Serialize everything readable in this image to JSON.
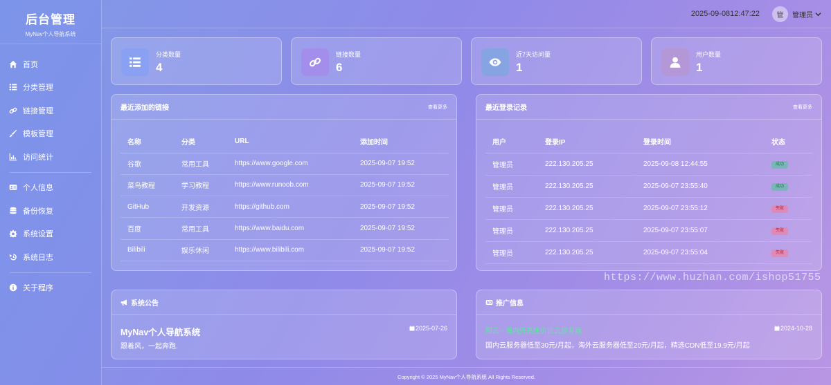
{
  "brand": {
    "title": "后台管理",
    "subtitle": "MyNav个人导航系统"
  },
  "nav": [
    {
      "label": "首页",
      "icon": "home-icon"
    },
    {
      "label": "分类管理",
      "icon": "list-icon"
    },
    {
      "label": "链接管理",
      "icon": "link-icon"
    },
    {
      "label": "模板管理",
      "icon": "brush-icon"
    },
    {
      "label": "访问统计",
      "icon": "chart-icon"
    },
    {
      "label": "个人信息",
      "icon": "id-card-icon"
    },
    {
      "label": "备份恢复",
      "icon": "database-icon"
    },
    {
      "label": "系统设置",
      "icon": "gear-icon"
    },
    {
      "label": "系统日志",
      "icon": "history-icon"
    },
    {
      "label": "关于程序",
      "icon": "info-icon"
    }
  ],
  "header": {
    "datetime": "2025-09-0812:47:22",
    "avatar_text": "管",
    "user_label": "管理员"
  },
  "stats": [
    {
      "label": "分类数量",
      "value": "4",
      "icon": "list-icon",
      "color": "#8aa0f2"
    },
    {
      "label": "链接数量",
      "value": "6",
      "icon": "link-icon",
      "color": "#a48eec"
    },
    {
      "label": "近7天访问量",
      "value": "1",
      "icon": "eye-icon",
      "color": "#86a4e2"
    },
    {
      "label": "用户数量",
      "value": "1",
      "icon": "user-icon",
      "color": "#b497d6"
    }
  ],
  "recent_links": {
    "title": "最近添加的链接",
    "more": "查看更多",
    "headers": [
      "名称",
      "分类",
      "URL",
      "添加时间"
    ],
    "rows": [
      [
        "谷歌",
        "常用工具",
        "https://www.google.com",
        "2025-09-07 19:52"
      ],
      [
        "菜鸟教程",
        "学习教程",
        "https://www.runoob.com",
        "2025-09-07 19:52"
      ],
      [
        "GitHub",
        "开发资源",
        "https://github.com",
        "2025-09-07 19:52"
      ],
      [
        "百度",
        "常用工具",
        "https://www.baidu.com",
        "2025-09-07 19:52"
      ],
      [
        "Bilibili",
        "娱乐休闲",
        "https://www.bilibili.com",
        "2025-09-07 19:52"
      ]
    ]
  },
  "recent_logins": {
    "title": "最近登录记录",
    "more": "查看更多",
    "headers": [
      "用户",
      "登录IP",
      "登录时间",
      "状态"
    ],
    "rows": [
      [
        "管理员",
        "222.130.205.25",
        "2025-09-08 12:44:55",
        "成功"
      ],
      [
        "管理员",
        "222.130.205.25",
        "2025-09-07 23:55:40",
        "成功"
      ],
      [
        "管理员",
        "222.130.205.25",
        "2025-09-07 23:55:12",
        "失败"
      ],
      [
        "管理员",
        "222.130.205.25",
        "2025-09-07 23:55:07",
        "失败"
      ],
      [
        "管理员",
        "222.130.205.25",
        "2025-09-07 23:55:04",
        "失败"
      ]
    ]
  },
  "notice": {
    "title": "系统公告",
    "heading": "MyNav个人导航系统",
    "date": "2025-07-26",
    "body": "跟着风，一起奔跑."
  },
  "promo": {
    "title": "推广信息",
    "link_text": "阳云 - 海内外高性价比云服务器",
    "date": "2024-10-28",
    "body": "国内云服务器低至30元/月起，海外云服务器低至20元/月起，精选CDN低至19.9元/月起"
  },
  "footer": "Copyright © 2025 MyNav个人导航系统 All Rights Reserved.",
  "watermark": "https://www.huzhan.com/ishop51755",
  "colors": {
    "success_badge": "#48c88c",
    "fail_badge": "#ff788c",
    "promo_link": "#5ee6a0"
  }
}
